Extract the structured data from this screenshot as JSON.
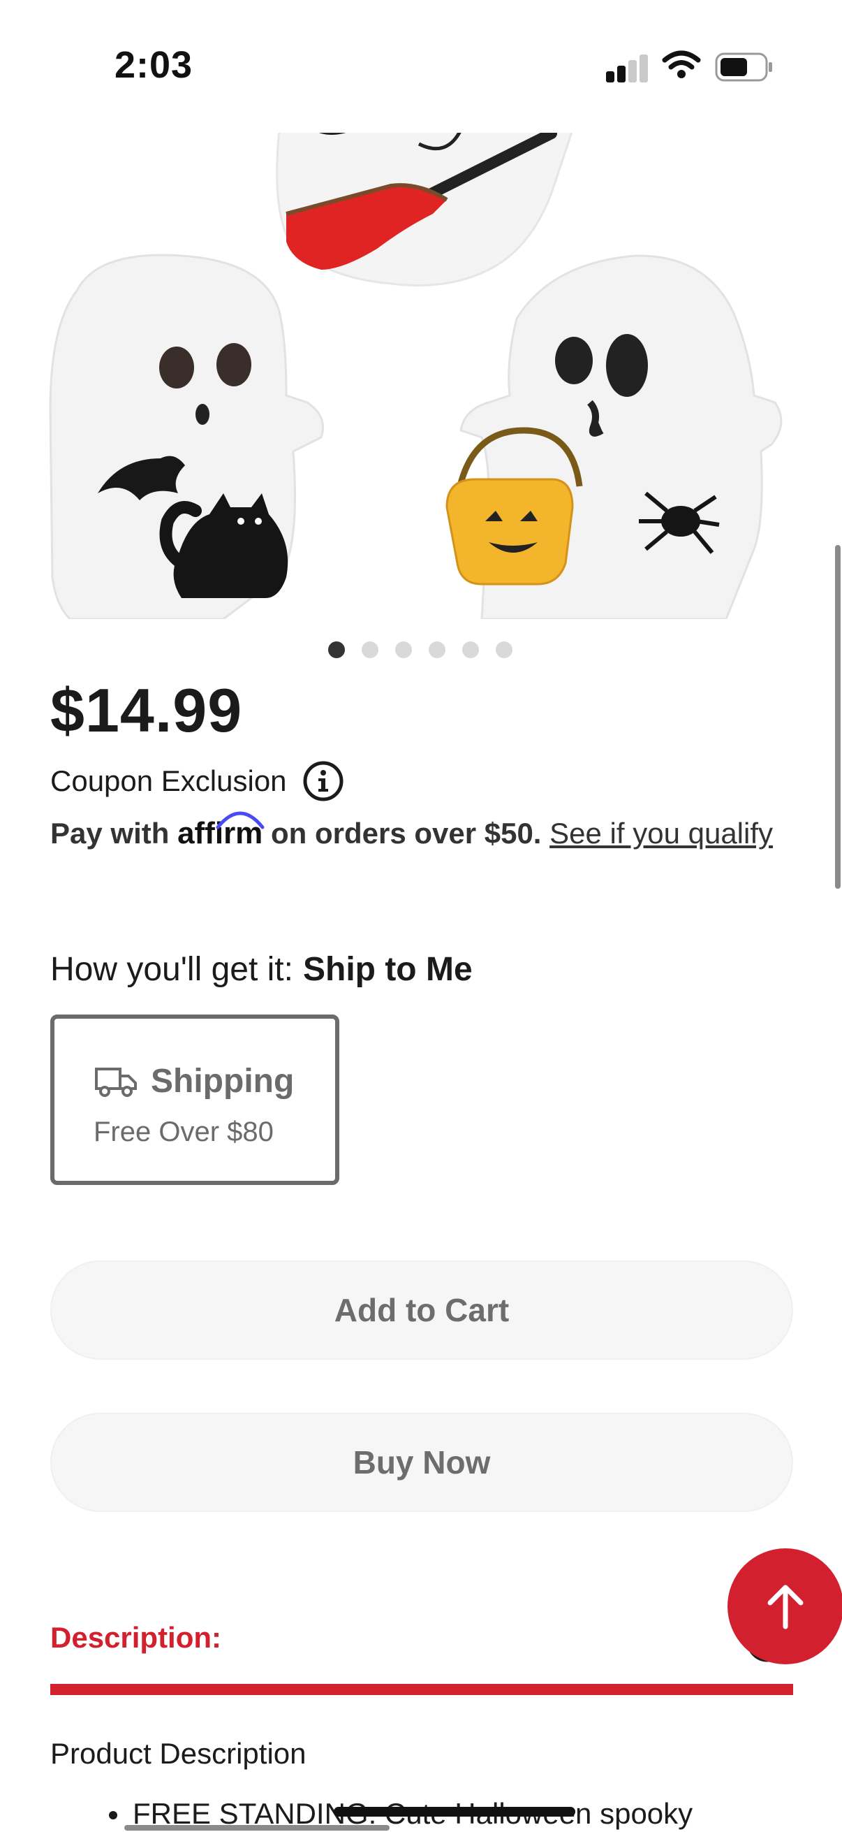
{
  "status_bar": {
    "time": "2:03"
  },
  "product": {
    "price": "$14.99",
    "coupon_exclusion": "Coupon Exclusion",
    "affirm": {
      "prefix": "Pay with",
      "logo": "affirm",
      "suffix": "on orders over $50.",
      "link": "See if you qualify"
    },
    "carousel": {
      "total": 6,
      "active_index": 0
    }
  },
  "fulfillment": {
    "label": "How you'll get it:",
    "value": "Ship to Me",
    "option": {
      "title": "Shipping",
      "subtitle": "Free Over $80"
    }
  },
  "actions": {
    "add_to_cart": "Add to Cart",
    "buy_now": "Buy Now"
  },
  "description": {
    "title": "Description:",
    "subtitle": "Product Description",
    "bullet": "FREE STANDING: Cute Halloween spooky"
  },
  "colors": {
    "accent": "#d3202e",
    "affirm_arc": "#4a4af4"
  },
  "icons": [
    "info-icon",
    "truck-icon",
    "arrow-up-icon",
    "minus-circle-icon",
    "wifi-icon",
    "battery-icon",
    "signal-icon"
  ]
}
